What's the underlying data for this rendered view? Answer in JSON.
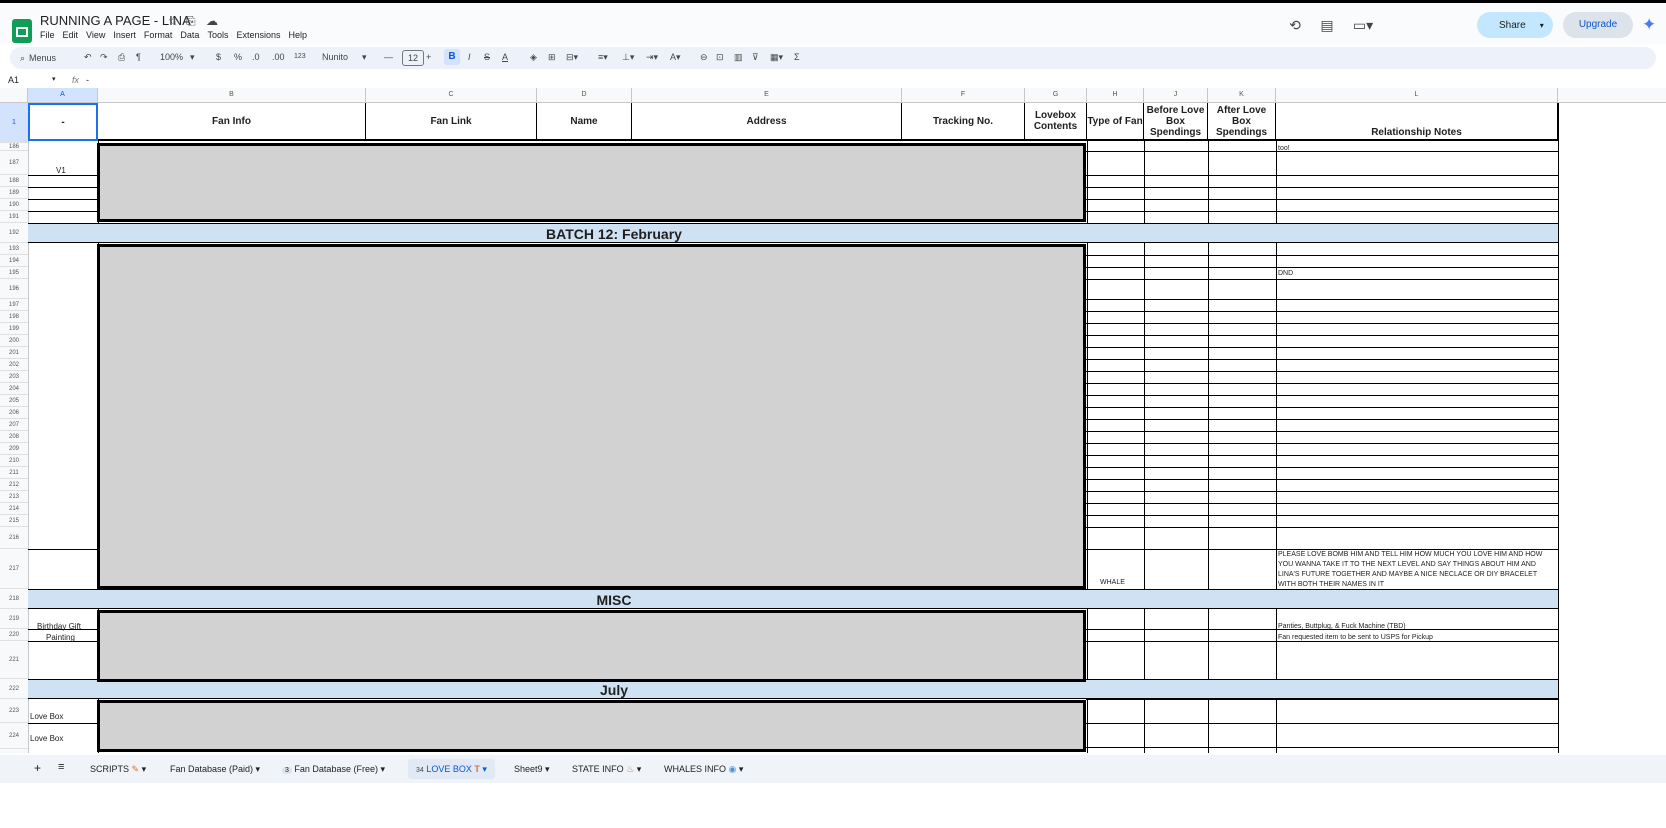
{
  "app": {
    "doc_title": "RUNNING A PAGE - LINA",
    "menu": [
      "File",
      "Edit",
      "View",
      "Insert",
      "Format",
      "Data",
      "Tools",
      "Extensions",
      "Help"
    ],
    "share_label": "Share",
    "upgrade_label": "Upgrade"
  },
  "toolbar": {
    "menus_label": "Menus",
    "zoom": "100%",
    "currency": "$",
    "percent": "%",
    "dec_decrease": ".0",
    ".dec_increase": ".00",
    "dec_increase": ".00",
    "number_format": "123",
    "font": "Nunito",
    "font_size": "12",
    "bold": "B",
    "italic": "I",
    "strike": "S",
    "text_color": "A"
  },
  "formula_bar": {
    "cell_ref": "A1",
    "fx": "fx",
    "content": "-"
  },
  "columns": [
    "A",
    "B",
    "C",
    "D",
    "E",
    "F",
    "G",
    "H",
    "J",
    "K",
    "L"
  ],
  "header_row": {
    "row_number": "1",
    "a": "-",
    "b": "Fan Info",
    "c": "Fan Link",
    "d": "Name",
    "e": "Address",
    "f": "Tracking No.",
    "g": "Lovebox Contents",
    "h": "Type of Fan",
    "j": "Before Love Box Spendings",
    "k": "After Love Box Spendings",
    "l": "Relationship Notes"
  },
  "rows": {
    "r186": "186",
    "r187": "187",
    "r188": "188",
    "r189": "189",
    "r190": "190",
    "r191": "191",
    "r192": "192",
    "r193": "193",
    "r194": "194",
    "r195": "195",
    "r196": "196",
    "r197": "197",
    "r198": "198",
    "r199": "199",
    "r200": "200",
    "r201": "201",
    "r202": "202",
    "r203": "203",
    "r204": "204",
    "r205": "205",
    "r206": "206",
    "r207": "207",
    "r208": "208",
    "r209": "209",
    "r210": "210",
    "r211": "211",
    "r212": "212",
    "r213": "213",
    "r214": "214",
    "r215": "215",
    "r216": "216",
    "r217": "217",
    "r218": "218",
    "r219": "219",
    "r220": "220",
    "r221": "221",
    "r222": "222",
    "r223": "223",
    "r224": "224"
  },
  "cells": {
    "a187": "V1",
    "a219": "Birthday Gift",
    "a220": "Painting",
    "a223": "Love Box",
    "a224": "Love Box",
    "h217": "WHALE",
    "l186": "too!",
    "l195": "DND",
    "l217": "PLEASE LOVE BOMB HIM AND TELL HIM HOW MUCH YOU LOVE HIM AND HOW YOU WANNA TAKE IT TO THE NEXT LEVEL AND SAY THINGS ABOUT HIM AND LINA'S FUTURE TOGETHER AND MAYBE A NICE NECLACE OR DIY BRACELET WITH BOTH THEIR NAMES IN IT",
    "l219": "Panties, Buttplug, & Fuck Machine (TBD)",
    "l220": "Fan requested item to be sent to USPS for Pickup"
  },
  "sections": {
    "batch12": "BATCH 12: February",
    "misc": "MISC",
    "july": "July"
  },
  "sheet_tabs": {
    "scripts": "SCRIPTS",
    "fan_db_paid": "Fan Database (Paid)",
    "fan_db_free_badge": "3",
    "fan_db_free": "Fan Database (Free)",
    "love_box_badge": "34",
    "love_box": "LOVE BOX",
    "sheet9": "Sheet9",
    "state_info": "STATE INFO",
    "whales_info": "WHALES INFO"
  }
}
